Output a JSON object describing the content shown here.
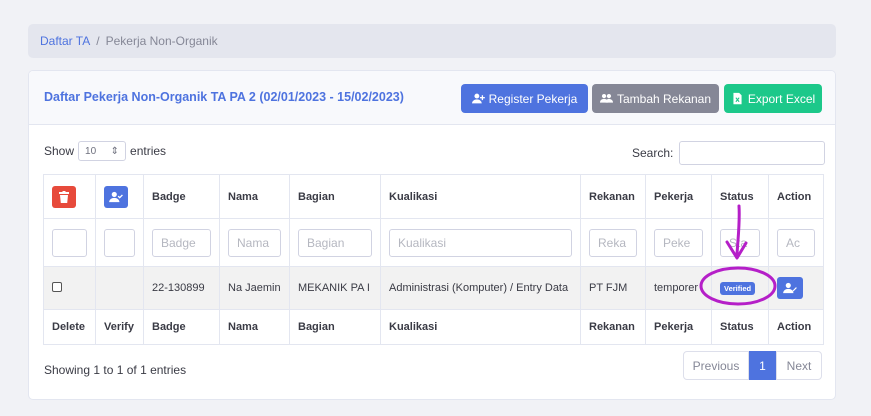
{
  "breadcrumb": {
    "link": "Daftar TA",
    "separator": "/",
    "current": "Pekerja Non-Organik"
  },
  "card": {
    "title": "Daftar Pekerja Non-Organik TA PA 2 (02/01/2023 - 15/02/2023)"
  },
  "buttons": {
    "register": "Register Pekerja",
    "tambah": "Tambah Rekanan",
    "export": "Export Excel"
  },
  "controls": {
    "show_label": "Show",
    "entries_value": "10",
    "entries_label": "entries",
    "search_label": "Search:"
  },
  "table": {
    "headers": [
      "Badge",
      "Nama",
      "Bagian",
      "Kualikasi",
      "Rekanan",
      "Pekerja",
      "Status",
      "Action"
    ],
    "filters": [
      "Badge",
      "Nama",
      "Bagian",
      "Kualikasi",
      "Reka",
      "Peke",
      "Sta",
      "Ac"
    ],
    "rows": [
      {
        "badge": "22-130899",
        "nama": "Na Jaemin",
        "bagian": "MEKANIK PA I",
        "kualikasi": "Administrasi (Komputer) / Entry Data",
        "rekanan": "PT FJM",
        "pekerja": "temporer",
        "status": "Verified"
      }
    ],
    "footer": [
      "Delete",
      "Verify",
      "Badge",
      "Nama",
      "Bagian",
      "Kualikasi",
      "Rekanan",
      "Pekerja",
      "Status",
      "Action"
    ]
  },
  "info": "Showing 1 to 1 of 1 entries",
  "pagination": {
    "previous": "Previous",
    "current": "1",
    "next": "Next"
  },
  "colors": {
    "primary": "#4e73df",
    "danger": "#e74a3b",
    "success": "#1cc88a",
    "secondary": "#858796",
    "annotation": "#b51fc8"
  }
}
